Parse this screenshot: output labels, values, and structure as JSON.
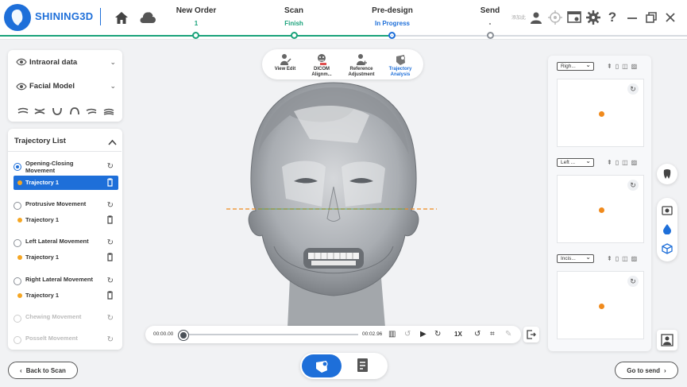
{
  "app": {
    "logo_text": "SHINING3D",
    "tiny_label": "添加此"
  },
  "steps": [
    {
      "label": "New Order",
      "status": "1",
      "status_color": "#19a27a"
    },
    {
      "label": "Scan",
      "status": "Finish",
      "status_color": "#19a27a"
    },
    {
      "label": "Pre-design",
      "status": "In Progress",
      "status_color": "#1e6fd9"
    },
    {
      "label": "Send",
      "status": "-",
      "status_color": "#333333"
    }
  ],
  "header_icons": [
    "home-icon",
    "cloud-icon",
    "user-icon",
    "target-icon",
    "window-icon",
    "gear-icon",
    "help-icon",
    "minimize-icon",
    "restore-icon",
    "close-icon"
  ],
  "left_panel": {
    "intraoral": "Intraoral data",
    "facial": "Facial Model"
  },
  "trajectory": {
    "title": "Trajectory List",
    "movements": [
      {
        "label": "Opening-Closing Movement",
        "selected": true,
        "enabled": true,
        "item": "Trajectory 1",
        "item_selected": true
      },
      {
        "label": "Protrusive Movement",
        "selected": false,
        "enabled": true,
        "item": "Trajectory 1",
        "item_selected": false
      },
      {
        "label": "Left Lateral Movement",
        "selected": false,
        "enabled": true,
        "item": "Trajectory 1",
        "item_selected": false
      },
      {
        "label": "Right Lateral Movement",
        "selected": false,
        "enabled": true,
        "item": "Trajectory 1",
        "item_selected": false
      },
      {
        "label": "Chewing Movement",
        "selected": false,
        "enabled": false
      },
      {
        "label": "Posselt Movement",
        "selected": false,
        "enabled": false
      }
    ]
  },
  "toolbar": {
    "items": [
      {
        "label": "View Edit",
        "icon": "view-edit-icon",
        "active": false
      },
      {
        "label": "DICOM Alignm...",
        "icon": "dicom-icon",
        "active": false
      },
      {
        "label": "Reference Adjustment",
        "icon": "reference-icon",
        "active": false
      },
      {
        "label": "Trajectory Analysis",
        "icon": "trajectory-icon",
        "active": true
      }
    ]
  },
  "playback": {
    "start": "00:00.00",
    "end": "00:02.96",
    "speed": "1X",
    "progress": 0
  },
  "buttons": {
    "back": "Back to Scan",
    "next": "Go to send"
  },
  "views": [
    {
      "label": "Righ..."
    },
    {
      "label": "Left ..."
    },
    {
      "label": "Incis..."
    }
  ],
  "colors": {
    "accent": "#1e6fd9",
    "done": "#19a27a",
    "point": "#f08a1c",
    "trajectory_dot": "#f5a623"
  }
}
